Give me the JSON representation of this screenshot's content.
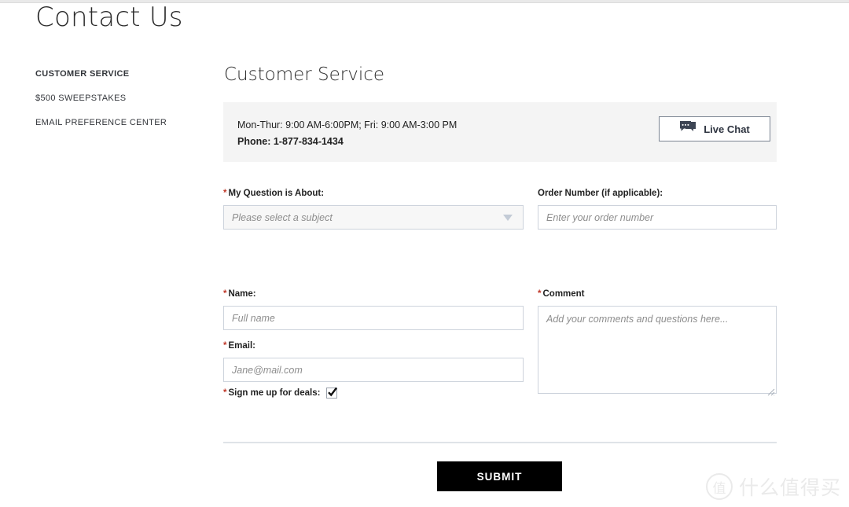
{
  "page": {
    "title": "Contact Us"
  },
  "sidebar": {
    "items": [
      {
        "label": "CUSTOMER SERVICE",
        "active": true
      },
      {
        "label": "$500 SWEEPSTAKES",
        "active": false
      },
      {
        "label": "EMAIL PREFERENCE CENTER",
        "active": false
      }
    ]
  },
  "main": {
    "section_title": "Customer Service",
    "info_bar": {
      "hours": "Mon-Thur: 9:00 AM-6:00PM;  Fri: 9:00 AM-3:00 PM",
      "phone": "Phone: 1-877-834-1434",
      "live_chat_label": "Live Chat",
      "live_chat_icon": "chat-bubble-icon",
      "background_color": "#f4f4f4"
    },
    "form": {
      "required_marker": "*",
      "subject": {
        "label": "My Question is About:",
        "required": true,
        "value": "",
        "placeholder": "Please select a subject",
        "caret_icon": "chevron-down-icon"
      },
      "order_number": {
        "label": "Order Number (if applicable):",
        "required": false,
        "value": "",
        "placeholder": "Enter your order number"
      },
      "name": {
        "label": "Name:",
        "required": true,
        "value": "",
        "placeholder": "Full name"
      },
      "email": {
        "label": "Email:",
        "required": true,
        "value": "",
        "placeholder": "Jane@mail.com"
      },
      "comment": {
        "label": "Comment",
        "required": true,
        "value": "",
        "placeholder": "Add your comments and questions here..."
      },
      "deals_optin": {
        "label": "Sign me up for deals:",
        "required": true,
        "checked": true
      },
      "submit_label": "SUBMIT"
    }
  },
  "watermark": {
    "logo_glyph": "值",
    "text": "什么值得买",
    "color": "#e8e8e8"
  },
  "colors": {
    "required_red": "#c0392b",
    "submit_bg": "#000000",
    "input_border": "#cdd3dc",
    "divider": "#dfe3e8"
  }
}
